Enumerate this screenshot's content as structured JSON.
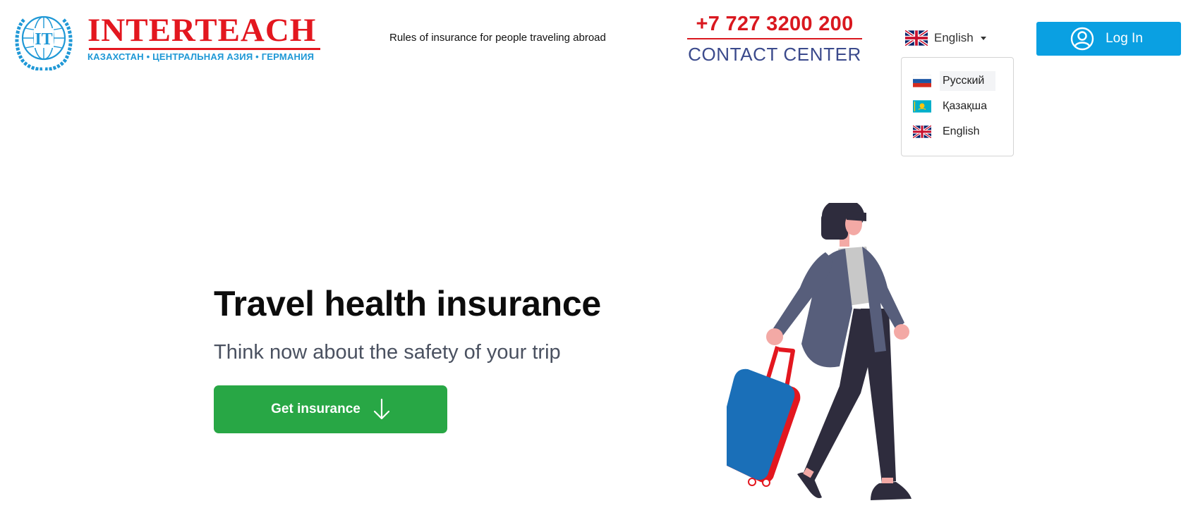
{
  "header": {
    "logo": {
      "wordmark": "INTERTEACH",
      "emblem_letters": "IT",
      "tagline": "КАЗАХСТАН • ЦЕНТРАЛЬНАЯ АЗИЯ • ГЕРМАНИЯ",
      "icon": "globe-laurel-icon"
    },
    "rules_link": "Rules of insurance for people traveling abroad",
    "contact": {
      "phone": "+7 727 3200 200",
      "label": "CONTACT CENTER"
    },
    "language": {
      "selected": "English",
      "selected_flag": "uk-flag-icon",
      "options": [
        {
          "label": "Русский",
          "flag": "russia-flag-icon"
        },
        {
          "label": "Қазақша",
          "flag": "kazakhstan-flag-icon"
        },
        {
          "label": "English",
          "flag": "uk-flag-icon"
        }
      ]
    },
    "login": {
      "label": "Log In",
      "icon": "user-circle-icon"
    }
  },
  "hero": {
    "title": "Travel health insurance",
    "subtitle": "Think now about the safety of your trip",
    "cta_label": "Get insurance",
    "cta_icon": "arrow-down-icon",
    "illustration": "woman-with-suitcase-illustration"
  },
  "colors": {
    "brand_red": "#e3171f",
    "brand_blue": "#1f98d6",
    "contact_blue": "#3b4a8c",
    "login_blue": "#0aa0e2",
    "cta_green": "#28a745"
  }
}
